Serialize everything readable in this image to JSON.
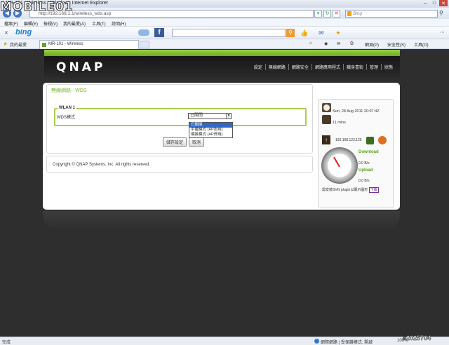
{
  "window": {
    "title": "MR-101 - Wireless - Windows Internet Explorer"
  },
  "address": {
    "url": "http://192.168.1.1/wireless_wds.asp"
  },
  "search": {
    "placeholder": "Bing"
  },
  "menu": [
    "檔案(F)",
    "編輯(E)",
    "檢視(V)",
    "我的最愛(A)",
    "工具(T)",
    "說明(H)"
  ],
  "favorites": {
    "label": "我的最愛",
    "tab": "MR-101 - Wireless"
  },
  "commands": [
    "網頁(P)",
    "安全性(S)",
    "工具(O)"
  ],
  "header": {
    "logo": "QNAP",
    "nav": [
      "設定",
      "無線網路",
      "網路安全",
      "網路應用程式",
      "職身喜街",
      "管理",
      "狀態"
    ]
  },
  "panel": {
    "title": "無線網路 - WDS",
    "legend": "WLAN 1",
    "field_label": "WDS模式",
    "select_value": "已關閉",
    "options": [
      "已關閉",
      "中繼模式 (AP設用)",
      "橋接模式 (AP停用)"
    ],
    "save_button": "儲存設定",
    "cancel_button": "取消"
  },
  "footer": {
    "copyright": "Copyright © QNAP Systems, Inc. All rights reserved."
  },
  "status": {
    "datetime": "Sun, 28 Aug 2011 20:07:42",
    "uptime": "11 mins",
    "ip": "192.168.123.125",
    "download_label": "Download",
    "download_value": "0.0 B/s",
    "upload_label": "Upload",
    "upload_value": "0.0 B/s",
    "plugin_text": "需安裝SVG plugin以顯示圖形",
    "plugin_link": "下載"
  },
  "statusbar": {
    "done": "完成",
    "zone": "網際網路 | 受保護模式: 開啟",
    "zoom": "100%"
  },
  "watermark": {
    "brand": "MOBILE01",
    "id": "#2025704"
  }
}
